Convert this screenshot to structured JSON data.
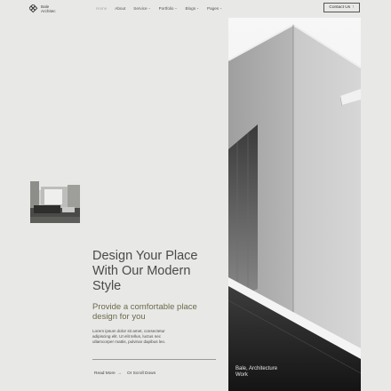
{
  "brand": {
    "line1": "Bale",
    "line2": "Architec",
    "logo_icon": "diamond-grid-logo"
  },
  "nav": {
    "items": [
      {
        "label": "Home",
        "has_caret": false,
        "active": true
      },
      {
        "label": "About",
        "has_caret": false,
        "active": false
      },
      {
        "label": "Service",
        "has_caret": true,
        "active": false
      },
      {
        "label": "Portfolio",
        "has_caret": true,
        "active": false
      },
      {
        "label": "Blogs",
        "has_caret": true,
        "active": false
      },
      {
        "label": "Pages",
        "has_caret": true,
        "active": false
      }
    ],
    "caret_glyph": "⌄"
  },
  "contact_button": {
    "label": "Contact Us",
    "icon_glyph": "↑"
  },
  "hero": {
    "title_lines": [
      "Design Your Place",
      "With Our Modern",
      "Style"
    ],
    "subtitle_lines": [
      "Provide a comfortable place",
      "design for you"
    ],
    "description_lines": [
      "Lorem ipsum dolor sit amet, consectetur",
      "adipiscing elit. Ut elit tellus, luctus nec",
      "ullamcorper mattis, pulvinar dapibus leo."
    ],
    "read_more": "Read More",
    "read_more_arrow": "→",
    "scroll_down": "Or Scroll Down"
  },
  "photo_caption": {
    "line1": "Bale, Architecture",
    "line2": "Work"
  },
  "colors": {
    "background": "#e8e8e7",
    "text": "#4a4a4a",
    "accent_olive": "#6d6a4a",
    "muted_nav": "#a9a9a9"
  }
}
